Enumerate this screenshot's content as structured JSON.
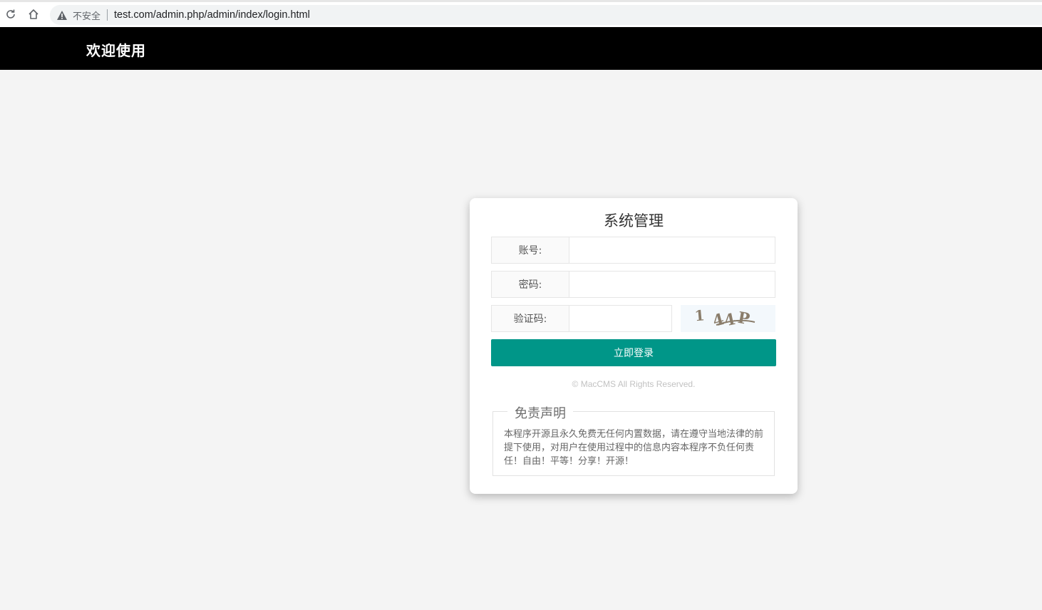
{
  "browser": {
    "security_label": "不安全",
    "url": "test.com/admin.php/admin/index/login.html"
  },
  "header": {
    "title": "欢迎使用"
  },
  "login": {
    "title": "系统管理",
    "username_label": "账号:",
    "password_label": "密码:",
    "captcha_label": "验证码:",
    "captcha_text": "1 4P",
    "submit_label": "立即登录",
    "copyright": "© MacCMS All Rights Reserved."
  },
  "disclaimer": {
    "title": "免责声明",
    "text": "本程序开源且永久免费无任何内置数据，请在遵守当地法律的前提下使用，对用户在使用过程中的信息内容本程序不负任何责任！自由！平等！分享！开源！"
  },
  "colors": {
    "header_bg": "#000000",
    "primary": "#009688",
    "page_bg": "#f4f4f4"
  }
}
